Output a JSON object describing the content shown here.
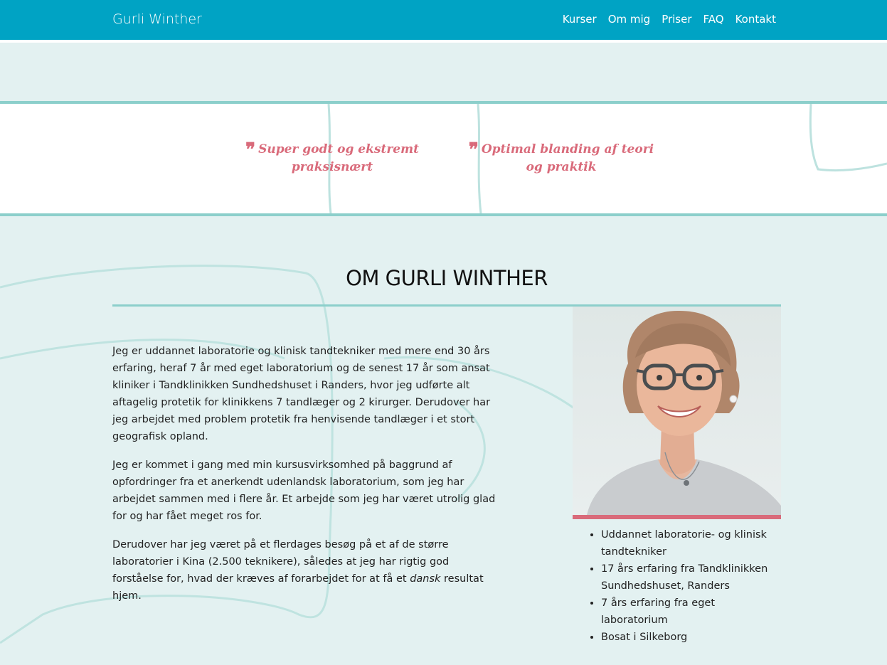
{
  "nav": {
    "brand": "Gurli Winther",
    "items": [
      "Kurser",
      "Om mig",
      "Priser",
      "FAQ",
      "Kontakt"
    ]
  },
  "quotes": [
    {
      "mark": "❞",
      "text": "Super godt og ekstremt praksisnært"
    },
    {
      "mark": "❞",
      "text": "Optimal blanding af teori og praktik"
    }
  ],
  "about": {
    "title": "OM GURLI WINTHER",
    "p1": "Jeg er uddannet laboratorie og klinisk tandtekniker med mere end 30 års erfaring, heraf 7 år med eget laboratorium og de senest 17 år som ansat kliniker i Tandklinikken Sundhedshuset i Randers, hvor jeg udførte alt aftagelig protetik for klinikkens 7 tandlæger og 2 kirurger. Derudover har jeg arbejdet med problem protetik fra henvisende tandlæger i et stort geografisk opland.",
    "p2": "Jeg er kommet i gang med min kursusvirksomhed på baggrund af opfordringer fra et anerkendt udenlandsk laboratorium, som jeg har arbejdet sammen med i flere år. Et arbejde som jeg har været utrolig glad for og har fået meget ros for.",
    "p3_before": "Derudover har jeg været på et flerdages besøg på et af de større laboratorier i Kina (2.500 teknikere), således at jeg har rigtig god forståelse for, hvad der kræves af forarbejdet for at få et ",
    "p3_em": "dansk",
    "p3_after": " resultat hjem.",
    "facts": [
      "Uddannet laboratorie- og klinisk tandtekniker",
      "17 års erfaring fra Tandklinikken Sundhedshuset, Randers",
      "7 års erfaring fra eget laboratorium",
      "Bosat i Silkeborg"
    ]
  },
  "colors": {
    "nav_bg": "#00a3c4",
    "accent_line": "#8ccfcb",
    "quote_pink": "#d96a7a",
    "section_bg": "#e3f1f1"
  }
}
